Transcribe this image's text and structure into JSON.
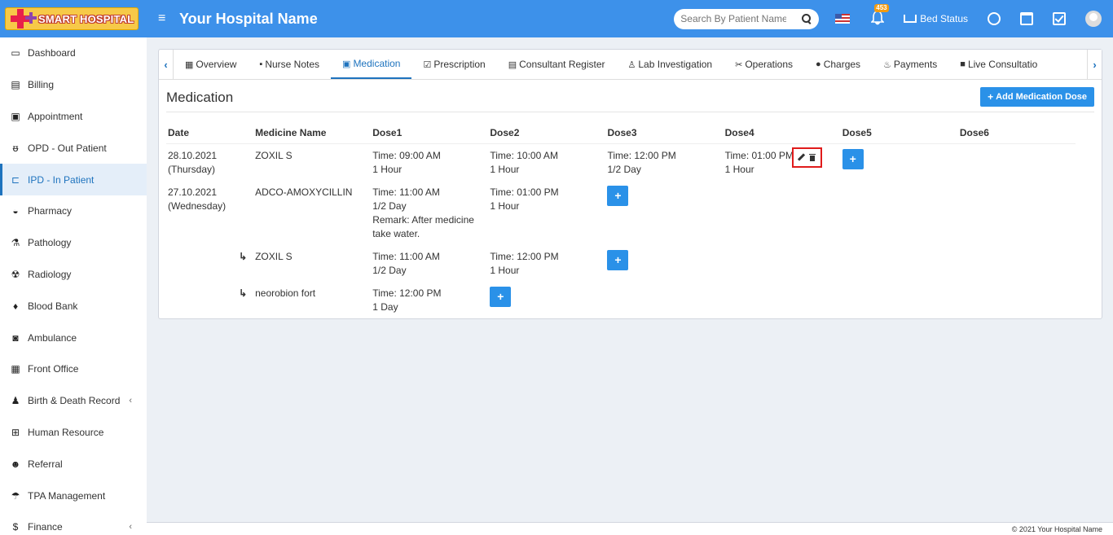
{
  "header": {
    "logo_text": "SMART HOSPITAL",
    "hospital_name": "Your Hospital Name",
    "search_placeholder": "Search By Patient Name",
    "notification_count": "453",
    "bed_status_label": "Bed Status",
    "brand_color": "#3d91ea"
  },
  "sidebar": {
    "items": [
      {
        "label": "Dashboard",
        "icon": "monitor-icon",
        "glyph": "▭"
      },
      {
        "label": "Billing",
        "icon": "file-icon",
        "glyph": "▤"
      },
      {
        "label": "Appointment",
        "icon": "calendar-check-icon",
        "glyph": "▣"
      },
      {
        "label": "OPD - Out Patient",
        "icon": "stethoscope-icon",
        "glyph": "ᵿ"
      },
      {
        "label": "IPD - In Patient",
        "icon": "bed-icon",
        "glyph": "⊏"
      },
      {
        "label": "Pharmacy",
        "icon": "mortar-pestle-icon",
        "glyph": "◒"
      },
      {
        "label": "Pathology",
        "icon": "flask-icon",
        "glyph": "⚗"
      },
      {
        "label": "Radiology",
        "icon": "xray-icon",
        "glyph": "☢"
      },
      {
        "label": "Blood Bank",
        "icon": "tint-icon",
        "glyph": "♦"
      },
      {
        "label": "Ambulance",
        "icon": "ambulance-icon",
        "glyph": "◙"
      },
      {
        "label": "Front Office",
        "icon": "building-icon",
        "glyph": "▦"
      },
      {
        "label": "Birth & Death Record",
        "icon": "family-icon",
        "glyph": "♟"
      },
      {
        "label": "Human Resource",
        "icon": "sitemap-icon",
        "glyph": "⊞"
      },
      {
        "label": "Referral",
        "icon": "users-icon",
        "glyph": "☻"
      },
      {
        "label": "TPA Management",
        "icon": "umbrella-icon",
        "glyph": "☂"
      },
      {
        "label": "Finance",
        "icon": "money-icon",
        "glyph": "$"
      }
    ],
    "active_index": 4
  },
  "tabs": [
    {
      "label": "Overview",
      "icon": "th-icon",
      "glyph": "▦"
    },
    {
      "label": "Nurse Notes",
      "icon": "sticky-note-icon",
      "glyph": "▪"
    },
    {
      "label": "Medication",
      "icon": "medkit-icon",
      "glyph": "▣"
    },
    {
      "label": "Prescription",
      "icon": "calendar-check-icon",
      "glyph": "☑"
    },
    {
      "label": "Consultant Register",
      "icon": "file-prescription-icon",
      "glyph": "▤"
    },
    {
      "label": "Lab Investigation",
      "icon": "microscope-icon",
      "glyph": "♙"
    },
    {
      "label": "Operations",
      "icon": "scissors-icon",
      "glyph": "✂"
    },
    {
      "label": "Charges",
      "icon": "donate-icon",
      "glyph": "●"
    },
    {
      "label": "Payments",
      "icon": "hand-holding-usd-icon",
      "glyph": "♨"
    },
    {
      "label": "Live Consultatio",
      "icon": "video-icon",
      "glyph": "■"
    }
  ],
  "active_tab": 2,
  "medication": {
    "title": "Medication",
    "add_button": "Add Medication Dose",
    "columns": [
      "Date",
      "Medicine Name",
      "Dose1",
      "Dose2",
      "Dose3",
      "Dose4",
      "Dose5",
      "Dose6"
    ],
    "rows": [
      {
        "date": "28.10.2021",
        "day": "(Thursday)",
        "medicine": "ZOXIL S",
        "sub": false,
        "doses": [
          {
            "time": "Time: 09:00 AM",
            "qty": "1 Hour"
          },
          {
            "time": "Time: 10:00 AM",
            "qty": "1 Hour"
          },
          {
            "time": "Time: 12:00 PM",
            "qty": "1/2 Day"
          },
          {
            "time": "Time: 01:00 PM",
            "qty": "1 Hour"
          }
        ]
      },
      {
        "date": "27.10.2021",
        "day": "(Wednesday)",
        "medicine": "ADCO-AMOXYCILLIN",
        "sub": false,
        "doses": [
          {
            "time": "Time: 11:00 AM",
            "qty": "1/2 Day",
            "remark": "Remark: After medicine take water."
          },
          {
            "time": "Time: 01:00 PM",
            "qty": "1 Hour"
          }
        ]
      },
      {
        "date": "",
        "day": "",
        "medicine": "ZOXIL S",
        "sub": true,
        "doses": [
          {
            "time": "Time: 11:00 AM",
            "qty": "1/2 Day"
          },
          {
            "time": "Time: 12:00 PM",
            "qty": "1 Hour"
          }
        ]
      },
      {
        "date": "",
        "day": "",
        "medicine": "neorobion fort",
        "sub": true,
        "doses": [
          {
            "time": "Time: 12:00 PM",
            "qty": "1 Day"
          }
        ]
      }
    ]
  },
  "footer": {
    "copyright": "© 2021 Your Hospital Name"
  }
}
